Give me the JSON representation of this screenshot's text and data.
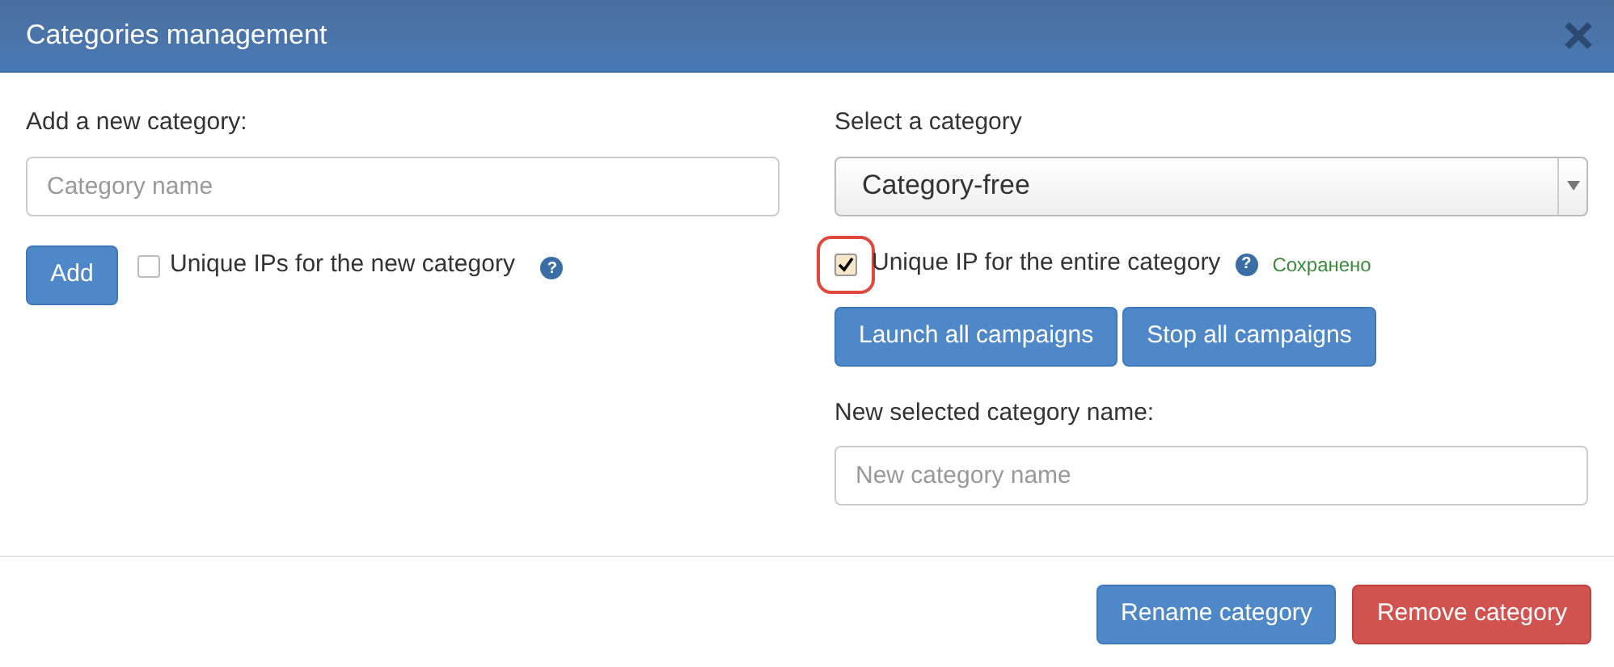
{
  "window": {
    "title": "Categories management"
  },
  "add_section": {
    "label": "Add a new category:",
    "field": {
      "placeholder": "Category name"
    },
    "button": "Add",
    "checkbox": {
      "label": "Unique IPs for the new category",
      "checked": false,
      "help": "?"
    }
  },
  "select_section": {
    "label": "Select a category",
    "select": {
      "value": "Category-free"
    },
    "checkbox": {
      "label": "Unique IP for the entire category",
      "checked": true,
      "highlighted": true,
      "help": "?",
      "status": "Сохранено"
    },
    "buttons": [
      "Launch all campaigns",
      "Stop all campaigns"
    ],
    "rename_label": "New selected category name:",
    "rename_field": {
      "placeholder": "New category name"
    }
  },
  "footer": {
    "buttons": [
      {
        "label": "Rename category",
        "kind": "primary"
      },
      {
        "label": "Remove category",
        "kind": "danger"
      }
    ]
  }
}
